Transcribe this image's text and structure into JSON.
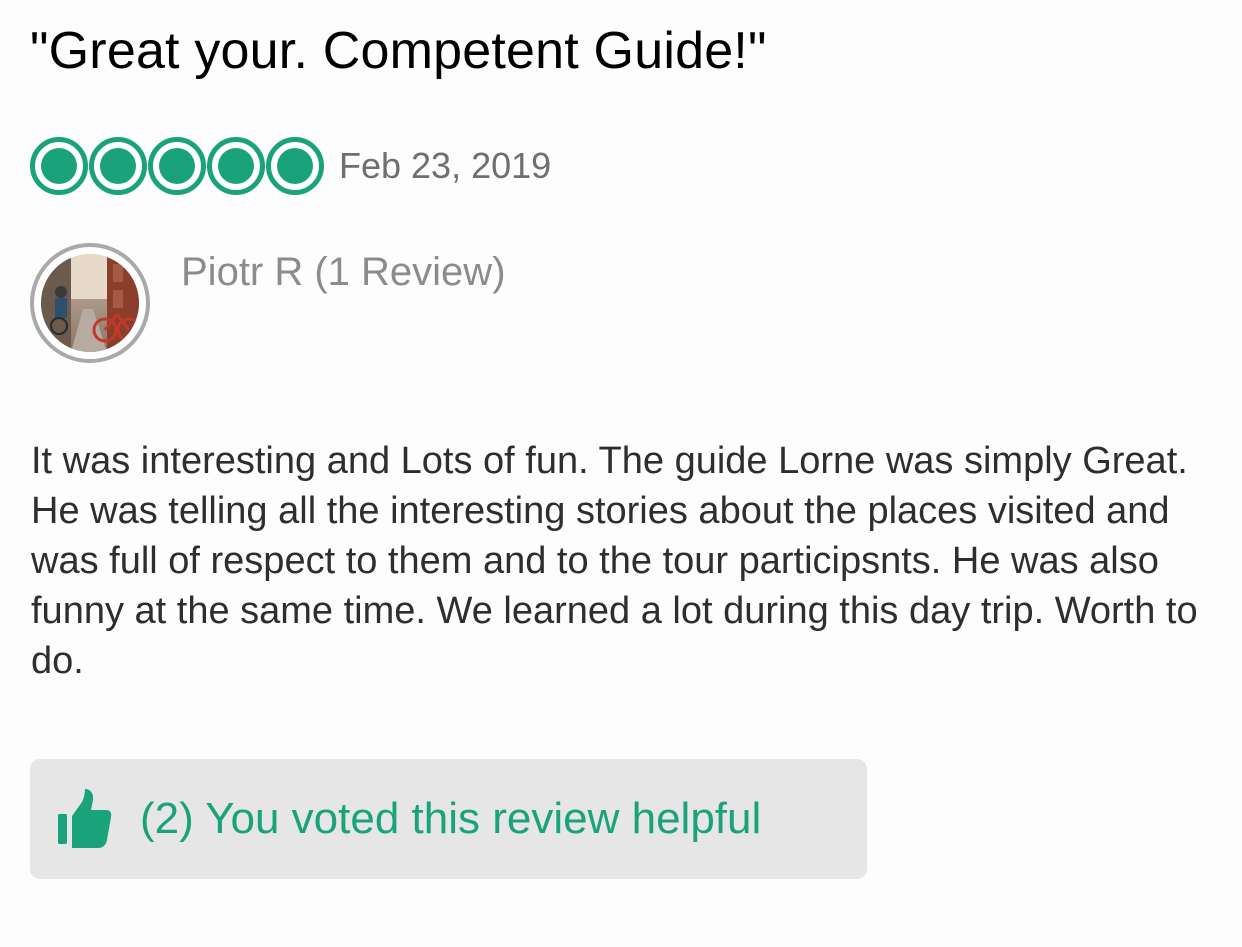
{
  "review": {
    "title": "\"Great your. Competent Guide!\"",
    "rating": {
      "value": 5,
      "max": 5,
      "color": "#1aa37a"
    },
    "date": "Feb 23, 2019",
    "reviewer": {
      "name_line": "Piotr R (1 Review)",
      "avatar_icon": "avatar-photo-street-bicycle"
    },
    "body": "It was interesting and Lots of fun. The guide Lorne was simply Great. He was telling all the interesting stories about the places visited and was full of respect to them and to the tour participsnts. He was also funny at the same time. We learned a lot during this day trip. Worth to do.",
    "helpful": {
      "label": "(2) You voted this review helpful",
      "icon": "thumbs-up-icon",
      "color": "#1aa37a",
      "background": "#e6e6e6"
    }
  }
}
